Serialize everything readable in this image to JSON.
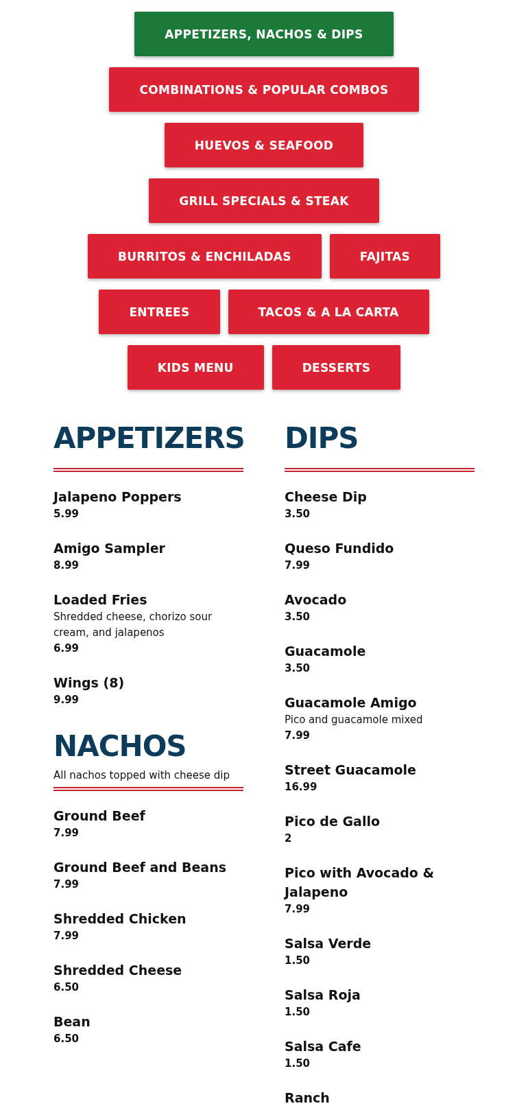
{
  "nav_rows": [
    [
      {
        "label": "APPETIZERS, NACHOS & DIPS",
        "selected": true
      }
    ],
    [
      {
        "label": "COMBINATIONS & POPULAR COMBOS",
        "selected": false
      }
    ],
    [
      {
        "label": "HUEVOS & SEAFOOD",
        "selected": false
      }
    ],
    [
      {
        "label": "GRILL SPECIALS & STEAK",
        "selected": false
      }
    ],
    [
      {
        "label": "BURRITOS & ENCHILADAS",
        "selected": false
      },
      {
        "label": "FAJITAS",
        "selected": false
      }
    ],
    [
      {
        "label": "ENTREES",
        "selected": false
      },
      {
        "label": "TACOS & A LA CARTA",
        "selected": false
      }
    ],
    [
      {
        "label": "KIDS MENU",
        "selected": false
      },
      {
        "label": "DESSERTS",
        "selected": false
      }
    ]
  ],
  "columns": [
    {
      "sections": [
        {
          "title": "APPETIZERS",
          "items": [
            {
              "name": "Jalapeno Poppers",
              "price": "5.99"
            },
            {
              "name": "Amigo Sampler",
              "price": "8.99"
            },
            {
              "name": "Loaded Fries",
              "description": "Shredded cheese, chorizo sour cream, and jalapenos",
              "price": "6.99"
            },
            {
              "name": "Wings (8)",
              "price": "9.99"
            }
          ]
        },
        {
          "title": "NACHOS",
          "description": "All nachos topped with cheese dip",
          "items": [
            {
              "name": "Ground Beef",
              "price": "7.99"
            },
            {
              "name": "Ground Beef and Beans",
              "price": "7.99"
            },
            {
              "name": "Shredded Chicken",
              "price": "7.99"
            },
            {
              "name": "Shredded Cheese",
              "price": "6.50"
            },
            {
              "name": "Bean",
              "price": "6.50"
            }
          ]
        }
      ]
    },
    {
      "sections": [
        {
          "title": "DIPS",
          "items": [
            {
              "name": "Cheese Dip",
              "price": "3.50"
            },
            {
              "name": "Queso Fundido",
              "price": "7.99"
            },
            {
              "name": "Avocado",
              "price": "3.50"
            },
            {
              "name": "Guacamole",
              "price": "3.50"
            },
            {
              "name": "Guacamole Amigo",
              "description": "Pico and guacamole mixed",
              "price": "7.99"
            },
            {
              "name": "Street Guacamole",
              "price": "16.99"
            },
            {
              "name": "Pico de Gallo",
              "price": "2"
            },
            {
              "name": "Pico with Avocado & Jalapeno",
              "price": "7.99"
            },
            {
              "name": "Salsa Verde",
              "price": "1.50"
            },
            {
              "name": "Salsa Roja",
              "price": "1.50"
            },
            {
              "name": "Salsa Cafe",
              "price": "1.50"
            },
            {
              "name": "Ranch"
            }
          ]
        }
      ]
    }
  ]
}
